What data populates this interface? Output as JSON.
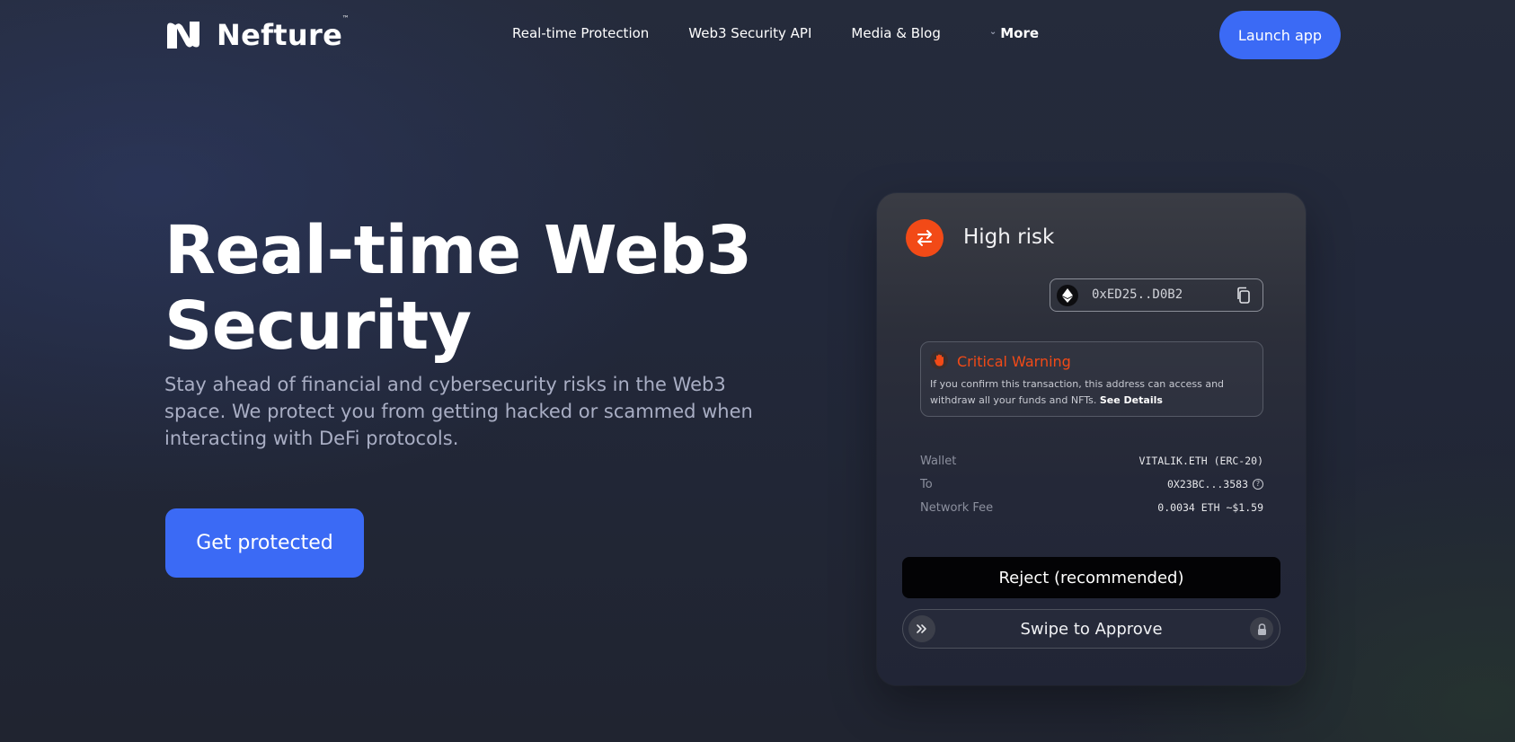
{
  "nav": {
    "logo_text": "Nefture",
    "logo_tm": "™",
    "links": [
      "Real-time Protection",
      "Web3 Security API",
      "Media & Blog"
    ],
    "more_label": "More",
    "launch_label": "Launch app"
  },
  "hero": {
    "title_line1": "Real-time Web3",
    "title_line2": "Security",
    "subtitle": "Stay ahead of financial and cybersecurity risks in the Web3 space. We protect you from getting hacked or scammed when interacting with DeFi protocols.",
    "cta_label": "Get protected"
  },
  "card": {
    "risk_title": "High risk",
    "address": "0xED25..D0B2",
    "warning": {
      "title": "Critical Warning",
      "text": "If you confirm this transaction, this address can access and withdraw all your funds and NFTs.",
      "link": "See Details"
    },
    "details": [
      {
        "label": "Wallet",
        "value": "VITALIK.ETH (ERC-20)"
      },
      {
        "label": "To",
        "value": "0X23BC...3583"
      },
      {
        "label": "Network Fee",
        "value": "0.0034 ETH ~$1.59"
      }
    ],
    "reject_label": "Reject (recommended)",
    "swipe_label": "Swipe to Approve"
  },
  "colors": {
    "accent": "#3b6af5",
    "danger": "#f24a17",
    "background": "#22283a"
  },
  "icons": [
    "logo-mark",
    "swap-arrows-icon",
    "ethereum-icon",
    "copy-icon",
    "hand-stop-icon",
    "info-icon",
    "double-chevron-right-icon",
    "lock-icon",
    "chevron-down-icon"
  ]
}
